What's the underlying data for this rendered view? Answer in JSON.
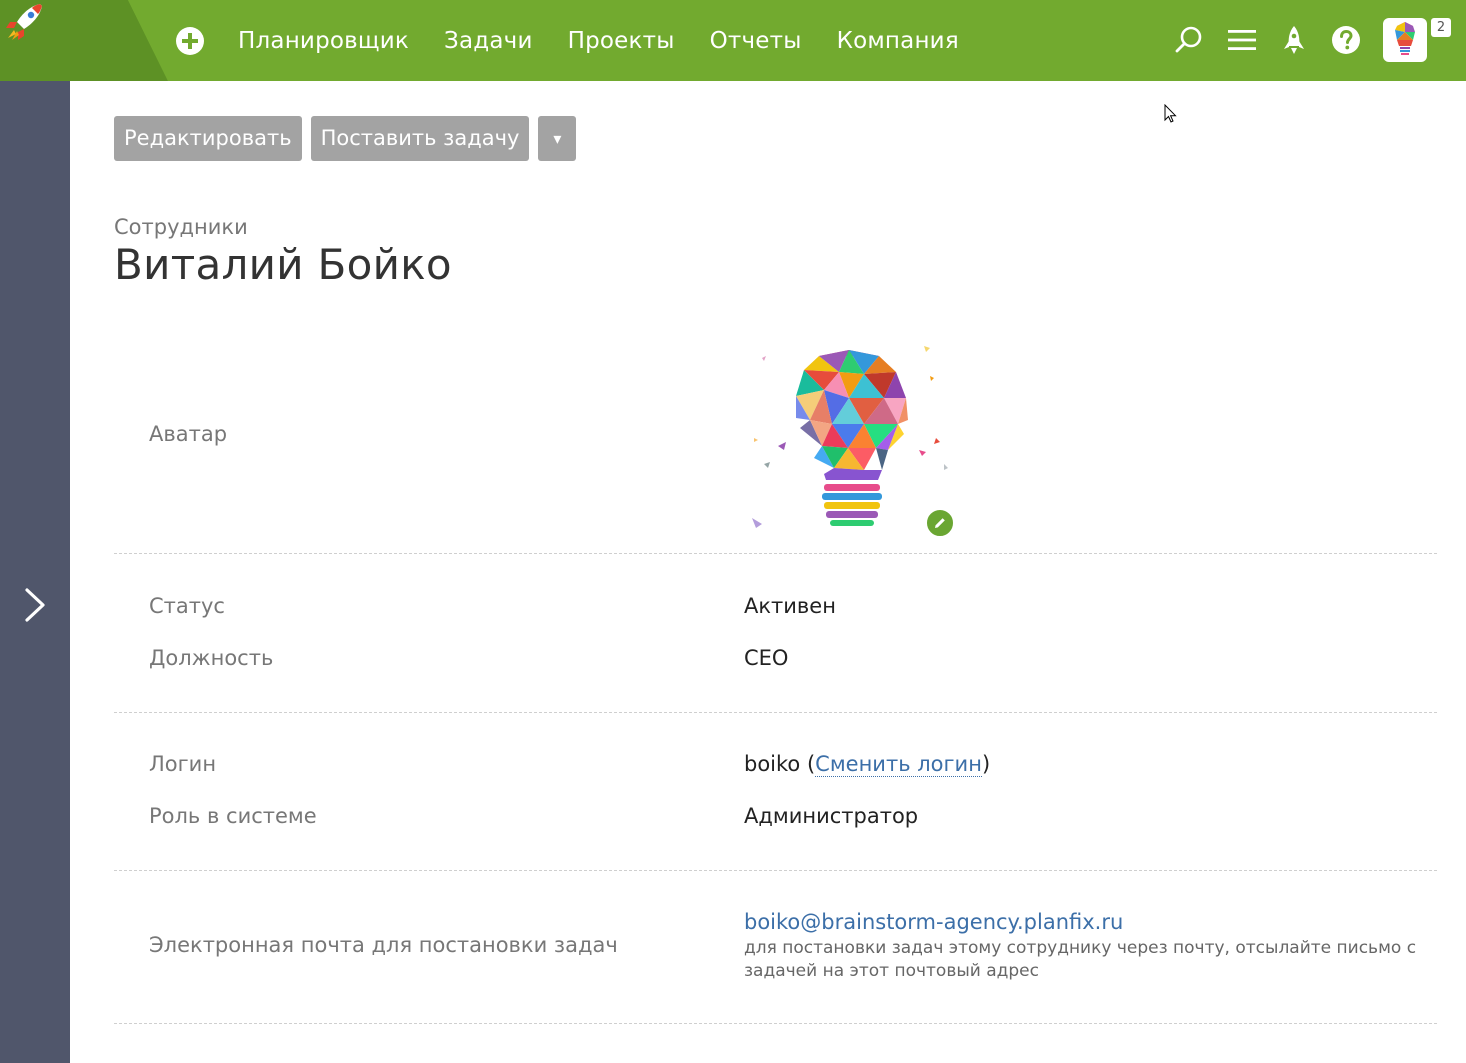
{
  "colors": {
    "topbar": "#72aa2f",
    "logo_bg": "#5d9125",
    "sidebar": "#50566b",
    "button": "#a3a3a3",
    "link": "#3c6fa8",
    "edit_badge": "#6aa632"
  },
  "header": {
    "logo_icon": "rocket-logo",
    "add_icon": "plus-circle-icon",
    "nav": [
      {
        "label": "Планировщик"
      },
      {
        "label": "Задачи"
      },
      {
        "label": "Проекты"
      },
      {
        "label": "Отчеты"
      },
      {
        "label": "Компания"
      }
    ],
    "icons": [
      "search-icon",
      "menu-icon",
      "rocket-icon",
      "help-icon"
    ],
    "notifications_count": "2"
  },
  "toolbar": {
    "edit_label": "Редактировать",
    "assign_task_label": "Поставить задачу",
    "more_label": "▾"
  },
  "page": {
    "breadcrumb": "Сотрудники",
    "title": "Виталий Бойко"
  },
  "fields": {
    "avatar_label": "Аватар",
    "status_label": "Статус",
    "status_value": "Активен",
    "position_label": "Должность",
    "position_value": "CEO",
    "login_label": "Логин",
    "login_value": "boiko",
    "login_open": " (",
    "change_login_link": "Сменить логин",
    "login_close": ")",
    "role_label": "Роль в системе",
    "role_value": "Администратор",
    "email_label": "Электронная почта для постановки задач",
    "email_value": "boiko@brainstorm-agency.planfix.ru",
    "email_hint": "для постановки задач этому сотруднику через почту, отсылайте письмо с задачей на этот почтовый адрес"
  }
}
